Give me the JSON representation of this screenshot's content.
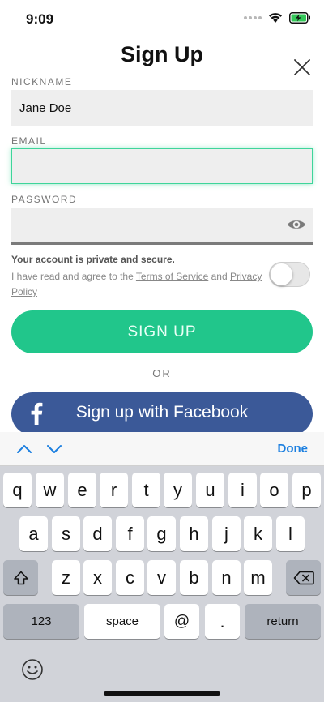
{
  "status_bar": {
    "time": "9:09"
  },
  "header": {
    "title": "Sign Up"
  },
  "form": {
    "nickname": {
      "label": "NICKNAME",
      "value": "Jane Doe"
    },
    "email": {
      "label": "EMAIL",
      "value": ""
    },
    "password": {
      "label": "PASSWORD",
      "value": ""
    },
    "privacy_title": "Your account is private and secure.",
    "terms_prefix": "I have read and agree to the",
    "terms_link": "Terms of Service",
    "terms_and": "and",
    "privacy_link": "Privacy Policy",
    "terms_toggle_on": false
  },
  "buttons": {
    "signup": "SIGN UP",
    "or": "OR",
    "facebook": "Sign up with Facebook"
  },
  "keyboard": {
    "done": "Done",
    "row1": [
      "q",
      "w",
      "e",
      "r",
      "t",
      "y",
      "u",
      "i",
      "o",
      "p"
    ],
    "row2": [
      "a",
      "s",
      "d",
      "f",
      "g",
      "h",
      "j",
      "k",
      "l"
    ],
    "row3": [
      "z",
      "x",
      "c",
      "v",
      "b",
      "n",
      "m"
    ],
    "numbers": "123",
    "space": "space",
    "at": "@",
    "dot": ".",
    "return": "return"
  },
  "colors": {
    "accent": "#21c68b",
    "facebook": "#3b5998",
    "focus": "#3ed59a",
    "link": "#1b7fe0"
  }
}
